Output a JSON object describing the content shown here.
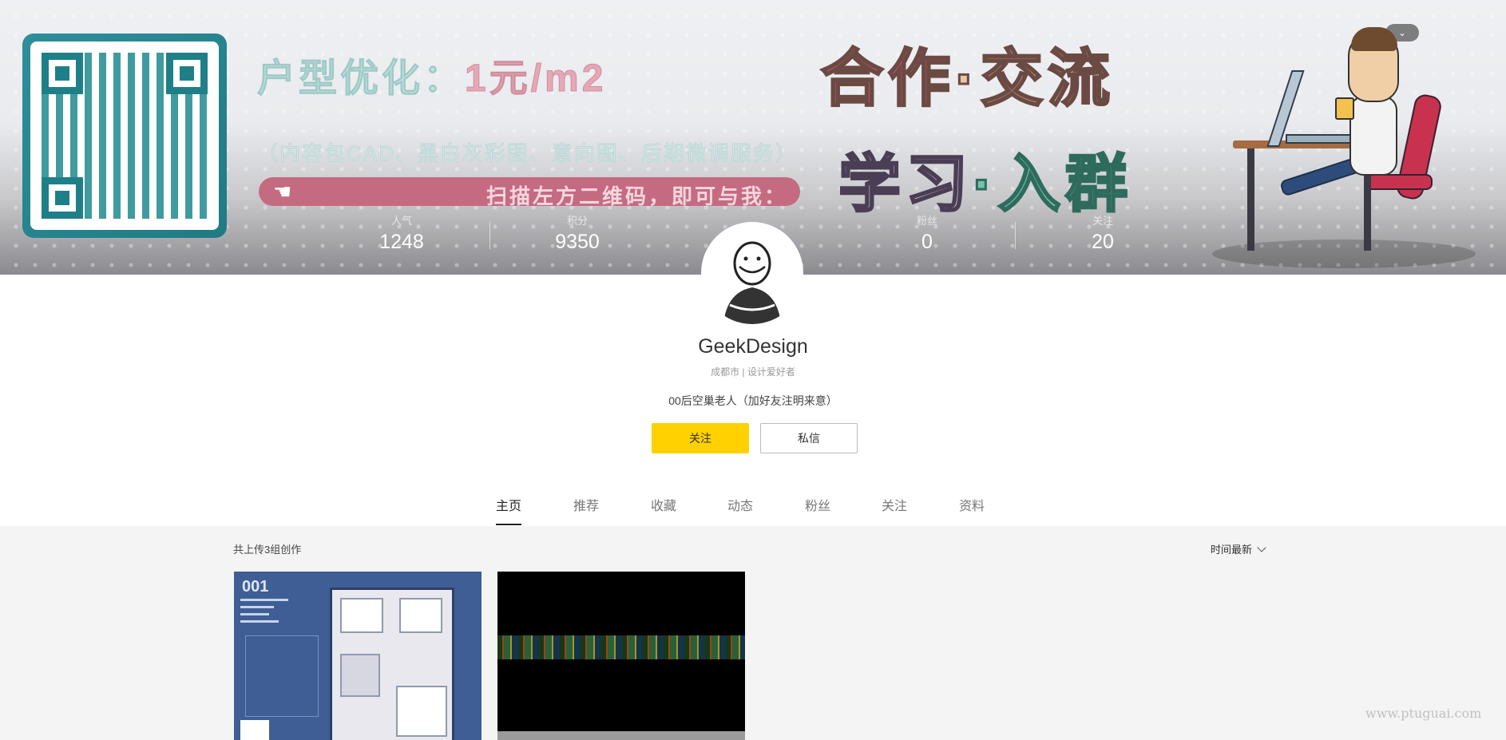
{
  "banner": {
    "promo_main": "户型优化：",
    "promo_price": "1元/m2",
    "promo_sub": "（内容包CAD、黑白灰彩图、意向图、后期微调服务）",
    "promo_bar": "扫描左方二维码，即可与我：",
    "slogan_line1_a": "合作",
    "slogan_line1_b": "·交流",
    "slogan_line2_a": "学习",
    "slogan_line2_b": "·入群",
    "toggle_icon": "chevron-down-icon"
  },
  "stats": [
    {
      "label": "人气",
      "value": "1248"
    },
    {
      "label": "积分",
      "value": "9350"
    },
    {
      "label": "粉丝",
      "value": "0"
    },
    {
      "label": "关注",
      "value": "20"
    }
  ],
  "profile": {
    "name": "GeekDesign",
    "meta": "成都市 | 设计爱好者",
    "bio": "00后空巢老人（加好友注明来意）",
    "follow_label": "关注",
    "message_label": "私信"
  },
  "tabs": [
    {
      "label": "主页",
      "active": true
    },
    {
      "label": "推荐"
    },
    {
      "label": "收藏"
    },
    {
      "label": "动态"
    },
    {
      "label": "粉丝"
    },
    {
      "label": "关注"
    },
    {
      "label": "资料"
    }
  ],
  "works": {
    "count_text": "共上传3组创作",
    "sort_label": "时间最新",
    "card1_title": "001"
  },
  "watermark": "www.ptuguai.com",
  "colors": {
    "accent_yellow": "#ffd100",
    "banner_pink": "#d9566b",
    "qr_teal": "#1f7f88"
  }
}
